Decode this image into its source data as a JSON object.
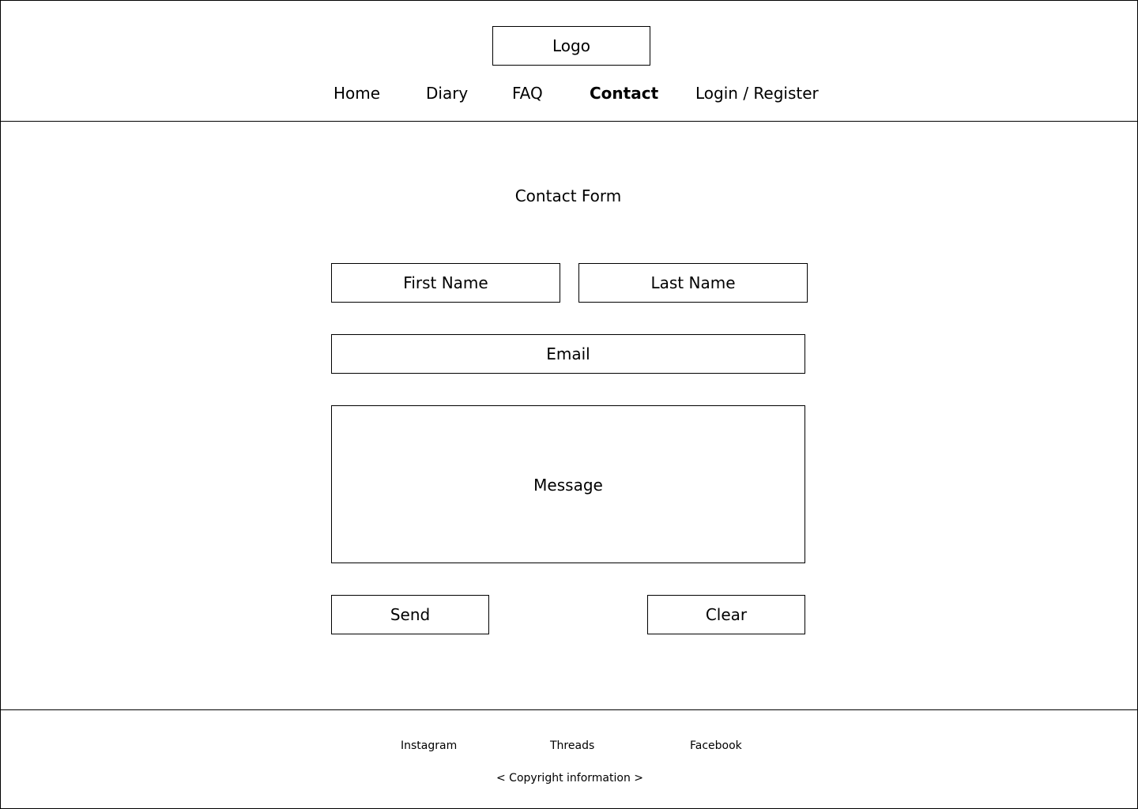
{
  "header": {
    "logo": "Logo",
    "nav": [
      {
        "label": "Home",
        "active": false
      },
      {
        "label": "Diary",
        "active": false
      },
      {
        "label": "FAQ",
        "active": false
      },
      {
        "label": "Contact",
        "active": true
      },
      {
        "label": "Login / Register",
        "active": false
      }
    ]
  },
  "main": {
    "title": "Contact Form",
    "form": {
      "first_name_placeholder": "First Name",
      "last_name_placeholder": "Last Name",
      "email_placeholder": "Email",
      "message_placeholder": "Message",
      "send_label": "Send",
      "clear_label": "Clear"
    }
  },
  "footer": {
    "links": [
      "Instagram",
      "Threads",
      "Facebook"
    ],
    "copyright": "< Copyright information >"
  }
}
